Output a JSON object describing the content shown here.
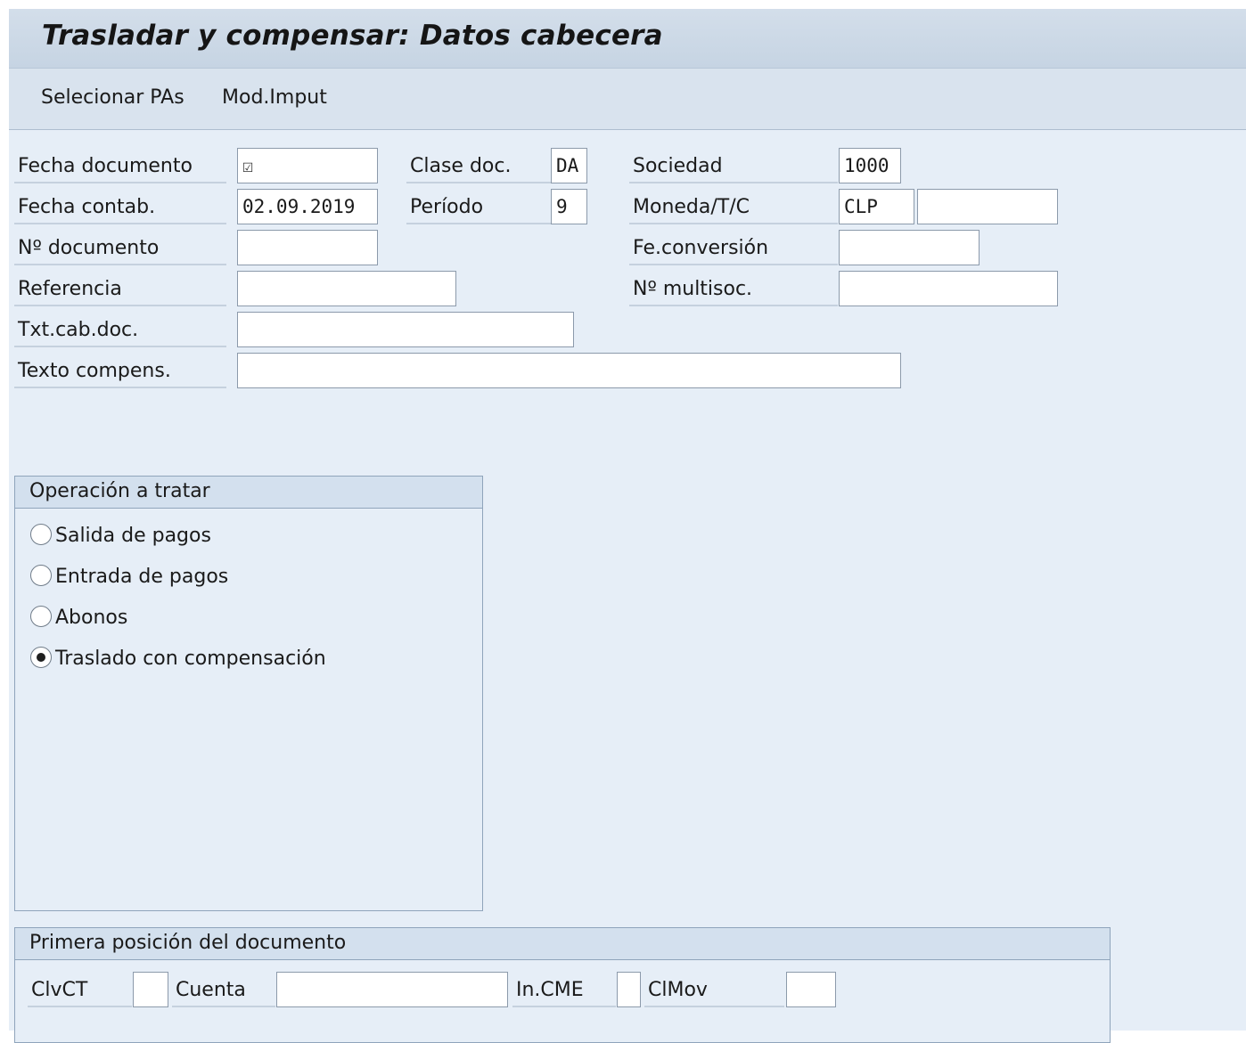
{
  "title": "Trasladar y compensar: Datos cabecera",
  "toolbar": {
    "select_items": "Selecionar PAs",
    "mod_imput": "Mod.Imput"
  },
  "header": {
    "fecha_documento": {
      "label": "Fecha documento",
      "value": "",
      "icon": "edit-check-icon"
    },
    "clase_doc": {
      "label": "Clase doc.",
      "value": "DA"
    },
    "sociedad": {
      "label": "Sociedad",
      "value": "1000"
    },
    "fecha_contab": {
      "label": "Fecha contab.",
      "value": "02.09.2019"
    },
    "periodo": {
      "label": "Período",
      "value": "9"
    },
    "moneda": {
      "label": "Moneda/T/C",
      "value": "CLP",
      "rate": ""
    },
    "no_documento": {
      "label": "Nº documento",
      "value": ""
    },
    "fe_conversion": {
      "label": "Fe.conversión",
      "value": ""
    },
    "referencia": {
      "label": "Referencia",
      "value": ""
    },
    "no_multisoc": {
      "label": "Nº multisoc.",
      "value": ""
    },
    "txt_cab_doc": {
      "label": "Txt.cab.doc.",
      "value": ""
    },
    "texto_compens": {
      "label": "Texto compens.",
      "value": ""
    }
  },
  "operacion": {
    "title": "Operación a tratar",
    "options": [
      {
        "label": "Salida de pagos",
        "selected": false
      },
      {
        "label": "Entrada de pagos",
        "selected": false
      },
      {
        "label": "Abonos",
        "selected": false
      },
      {
        "label": "Traslado con compensación",
        "selected": true
      }
    ]
  },
  "primera_posicion": {
    "title": "Primera posición del documento",
    "clvct": {
      "label": "ClvCT",
      "value": ""
    },
    "cuenta": {
      "label": "Cuenta",
      "value": ""
    },
    "in_cme": {
      "label": "In.CME",
      "value": ""
    },
    "clmov": {
      "label": "ClMov",
      "value": ""
    }
  }
}
